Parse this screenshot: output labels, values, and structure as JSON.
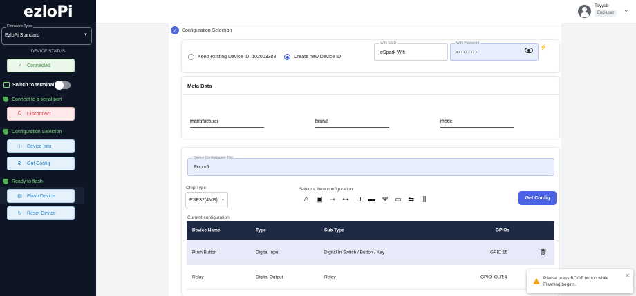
{
  "app": {
    "logo": "ezloPi"
  },
  "sidebar": {
    "firmware_label": "Firmware Type",
    "firmware_value": "EzloPi Standard",
    "device_status_title": "DEVICE STATUS",
    "connected_label": "Connected",
    "switch_terminal_label": "Switch to terminal",
    "connect_serial_label": "Connect to a serial port",
    "disconnect_label": "Disconnect",
    "config_selection_label": "Configuration Selection",
    "device_info_label": "Device Info",
    "get_config_label": "Get Config",
    "ready_flash_label": "Ready to flash",
    "flash_device_label": "Flash Device",
    "reset_device_label": "Reset Device",
    "switch_terminal_on": false
  },
  "user": {
    "name": "Tayyab",
    "role": "End-user"
  },
  "breadcrumb": {
    "label": "Configuration Selection"
  },
  "device_id": {
    "keep_label": "Keep existing Device ID: 102003303",
    "create_label": "Create new Device ID",
    "selected": "create"
  },
  "wifi": {
    "ssid_label": "WiFi SSID",
    "ssid_value": "eSpark Wifi",
    "password_label": "WiFi Password",
    "password_value": "•••••••••"
  },
  "meta": {
    "title": "Meta Data",
    "manufacturer_label": "Manufacturer",
    "manufacturer_value": "manufacturer",
    "brand_label": "Brand",
    "brand_value": "brand",
    "model_label": "Model",
    "model_value": "model"
  },
  "config": {
    "title_label": "Device Configuration Title",
    "title_value": "Room6",
    "chip_label": "Chip Type",
    "chip_value": "ESP32(4MB)",
    "select_new_label": "Select a New configuration",
    "get_config_button": "Get Config",
    "current_label": "Current configuration",
    "icons": [
      "led-icon",
      "relay-icon",
      "switch-icon",
      "sensor-icon",
      "box-sensor-icon",
      "serial-icon",
      "antenna-icon",
      "display-icon",
      "transfer-icon",
      "pins-icon"
    ]
  },
  "table": {
    "headers": [
      "Device Name",
      "Type",
      "Sub Type",
      "GPIOs"
    ],
    "rows": [
      {
        "name": "Push Button",
        "type": "Digital Input",
        "subtype": "Digital In Switch / Button / Key",
        "gpio": "GPIO:15"
      },
      {
        "name": "Relay",
        "type": "Digital Output",
        "subtype": "Relay",
        "gpio": "GPIO_OUT:4"
      }
    ]
  },
  "toast": {
    "message": "Please press BOOT button while Flashing begins."
  },
  "colors": {
    "accent": "#4a62e3",
    "sidebar_bg": "#0e1524",
    "table_header": "#1e2a44",
    "highlight_row": "#e8eaf9"
  }
}
